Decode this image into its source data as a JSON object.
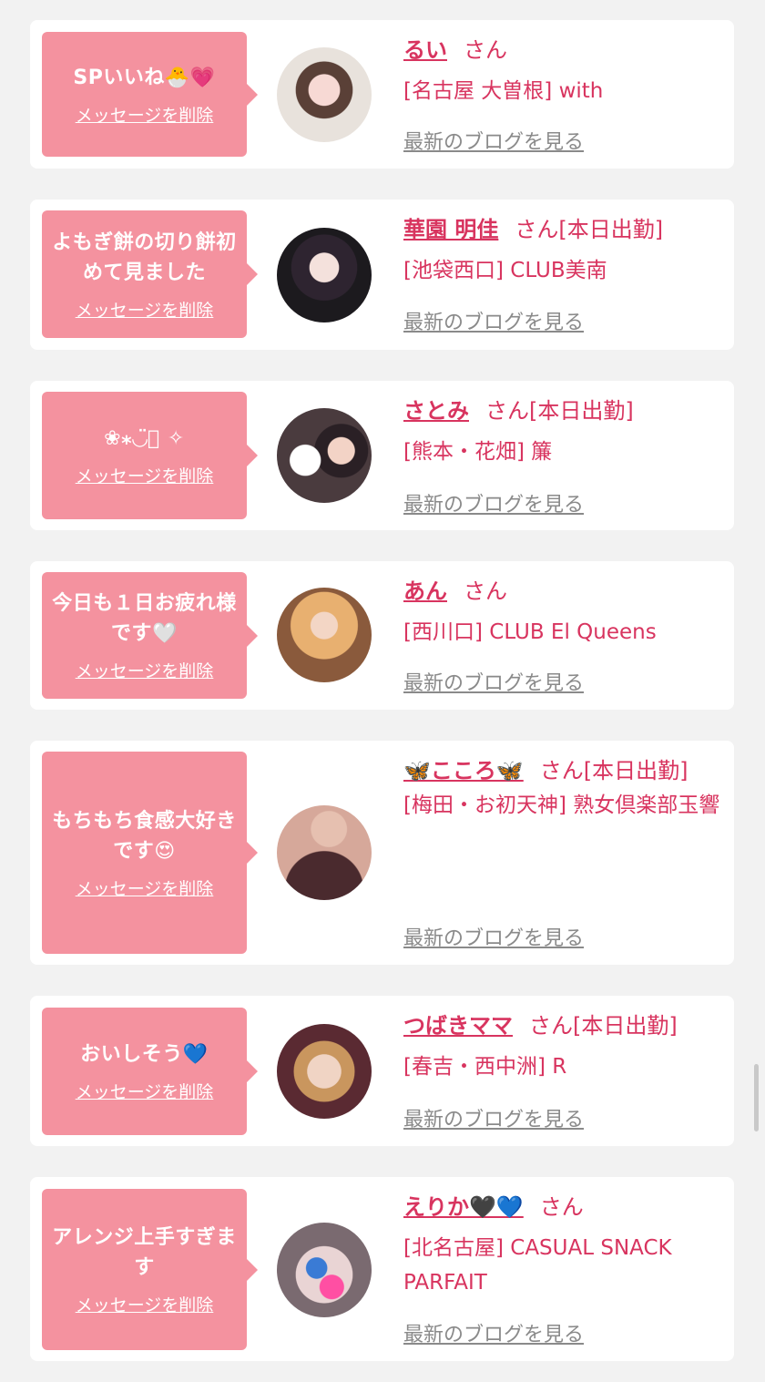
{
  "delete_label": "メッセージを削除",
  "blog_label": "最新のブログを見る",
  "honorific": "さん",
  "entries": [
    {
      "message": "SPいいね🐣💗",
      "name": "るい",
      "badge": "",
      "shop": "[名古屋 大曽根] with"
    },
    {
      "message": "よもぎ餅の切り餅初めて見ました",
      "name": "華園 明佳",
      "badge": "[本日出勤]",
      "shop": "[池袋西口] CLUB美南"
    },
    {
      "message": "❀⁎◡̈⃝ ✧",
      "name": "さとみ",
      "badge": "[本日出勤]",
      "shop": "[熊本・花畑] 簾"
    },
    {
      "message": "今日も１日お疲れ様です🤍",
      "name": "あん",
      "badge": "",
      "shop": "[西川口] CLUB El Queens"
    },
    {
      "message": "もちもち食感大好きです😍",
      "name": "🦋こころ🦋",
      "badge": "[本日出勤]",
      "shop": "[梅田・お初天神] 熟女倶楽部玉響"
    },
    {
      "message": "おいしそう💙",
      "name": "つばきママ",
      "badge": "[本日出勤]",
      "shop": "[春吉・西中洲] R"
    },
    {
      "message": "アレンジ上手すぎます",
      "name": "えりか🖤💙",
      "badge": "",
      "shop": "[北名古屋] CASUAL SNACK PARFAIT"
    }
  ],
  "colors": {
    "accent": "#d8345f",
    "bubble": "#f4929f",
    "muted": "#8a8a8a",
    "background": "#f2f2f2"
  }
}
